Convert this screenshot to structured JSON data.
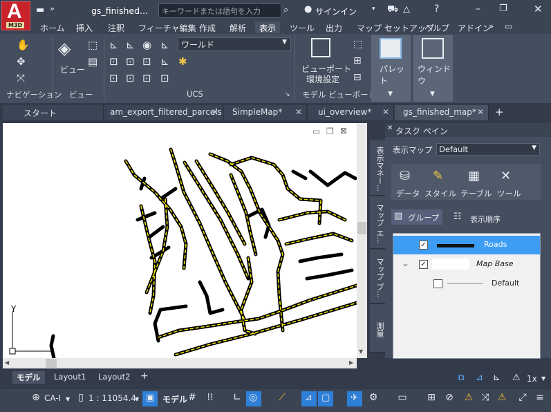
{
  "app": {
    "logo_text": "A",
    "logo_sub": "M3D",
    "title": "gs_finished...",
    "signin": "サインイン"
  },
  "search": {
    "placeholder": "キーワードまたは語句を入力"
  },
  "ribbon_tabs": [
    "ホーム",
    "挿入",
    "注釈",
    "フィーチャ編集",
    "作成",
    "解析",
    "表示",
    "ツール",
    "出力",
    "マップ セットアップ",
    "ヘルプ",
    "アドイン"
  ],
  "ribbon": {
    "view_label": "ビュー",
    "world": "ワールド",
    "viewport_label_1": "ビューポート",
    "viewport_label_2": "環境設定",
    "palette": "パレット",
    "window": "ウィンドウ",
    "panels": {
      "navigation": "ナビゲーション",
      "view": "ビュー",
      "ucs": "UCS",
      "model_viewport": "モデル ビューポート"
    }
  },
  "doc_tabs": [
    "スタート",
    "am_export_filtered_parcels",
    "SimpleMap*",
    "ui_overview*",
    "gs_finished_map*"
  ],
  "task_pane": {
    "title": "タスク ペイン",
    "display_map_label": "表示マップ",
    "display_map_value": "Default",
    "side_tabs": [
      "表示マネー...",
      "マップ エ...",
      "マップ ブ...",
      "測量"
    ],
    "tools": [
      "データ",
      "スタイル",
      "テーブル",
      "ツール"
    ],
    "group_label": "グループ",
    "draw_order_label": "表示順序",
    "layers": [
      {
        "name": "Roads",
        "checked": true,
        "selected": true
      },
      {
        "name": "Map Base",
        "checked": true,
        "selected": false
      },
      {
        "name": "Default",
        "checked": false,
        "selected": false
      }
    ]
  },
  "layout_tabs": [
    "モデル",
    "Layout1",
    "Layout2"
  ],
  "status": {
    "ca": "CA-I",
    "scale": "1 : 11054.4",
    "model": "モデル",
    "zoom": "1x"
  },
  "ucs_y": "Y",
  "colors": {
    "accent": "#3d9df5",
    "road_dash": "#f0e000",
    "logo_red": "#c8232b"
  }
}
